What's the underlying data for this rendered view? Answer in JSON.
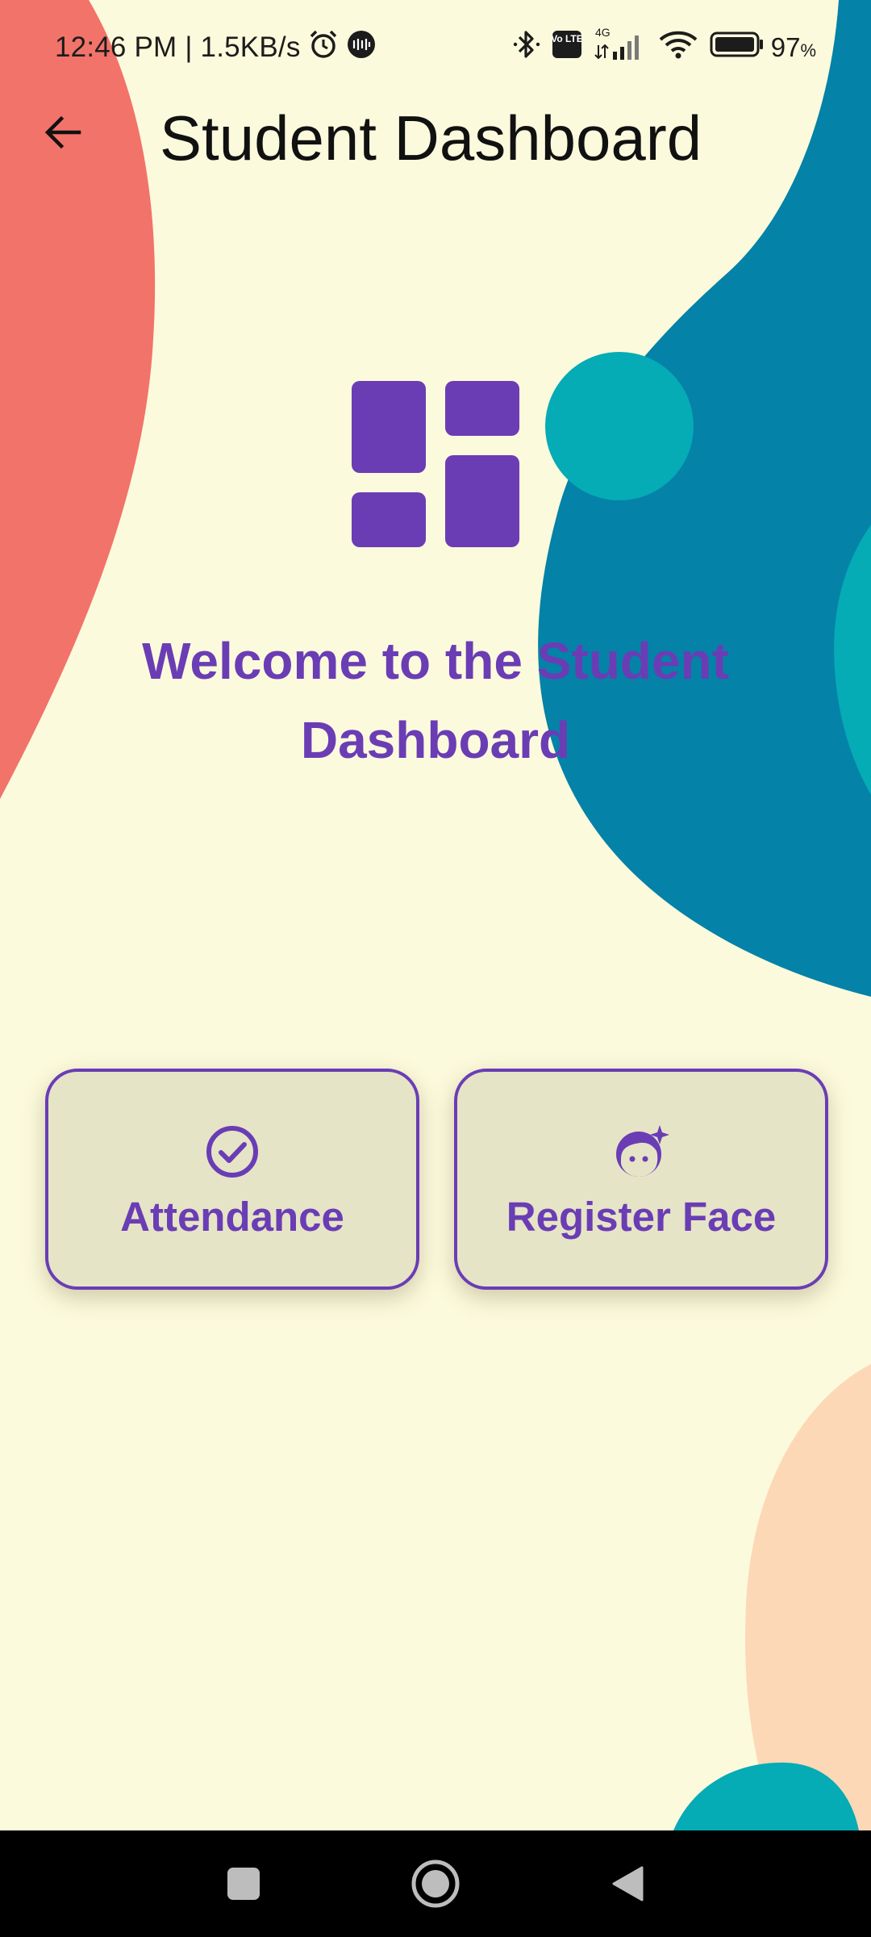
{
  "status_bar": {
    "time_and_speed": "12:46 PM | 1.5KB/s",
    "network_type": "4G",
    "volte_label": "Vo LTE",
    "battery_percent": "97",
    "battery_unit": "%",
    "icons": [
      "alarm-icon",
      "mi-music-icon",
      "bluetooth-icon",
      "volte-icon",
      "cellular-signal-icon",
      "wifi-icon",
      "battery-icon"
    ]
  },
  "app_bar": {
    "title": "Student Dashboard",
    "back_icon": "arrow-left-icon"
  },
  "hero": {
    "icon": "dashboard-grid-icon",
    "welcome_line1": "Welcome to the Student",
    "welcome_line2": "Dashboard"
  },
  "actions": [
    {
      "label": "Attendance",
      "icon": "check-circle-icon"
    },
    {
      "label": "Register Face",
      "icon": "face-sparkle-icon"
    }
  ],
  "nav_bar": {
    "icons": [
      "recents-square-icon",
      "home-circle-icon",
      "back-triangle-icon"
    ]
  },
  "colors": {
    "background": "#fcfadc",
    "accent": "#6a3db5",
    "card_fill": "#e6e4c6",
    "blob_coral": "#f27369",
    "blob_blue": "#0482a8",
    "blob_teal": "#05abb5",
    "blob_peach": "#fcd8b6"
  }
}
